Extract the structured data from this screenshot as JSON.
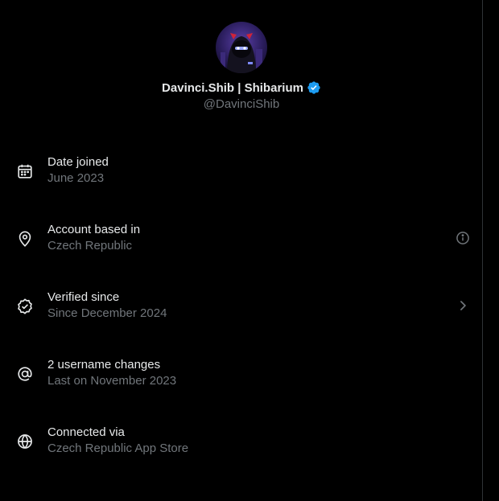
{
  "profile": {
    "display_name": "Davinci.Shib | Shibarium",
    "handle": "@DavinciShib",
    "verified": true,
    "avatar_icon": "hooded-ninja-avatar"
  },
  "rows": [
    {
      "icon": "calendar-icon",
      "title": "Date joined",
      "subtitle": "June 2023",
      "action": ""
    },
    {
      "icon": "location-pin-icon",
      "title": "Account based in",
      "subtitle": "Czech Republic",
      "action": "info-icon"
    },
    {
      "icon": "verified-check-icon",
      "title": "Verified since",
      "subtitle": "Since December 2024",
      "action": "chevron-right-icon"
    },
    {
      "icon": "at-sign-icon",
      "title": "2 username changes",
      "subtitle": "Last on November 2023",
      "action": ""
    },
    {
      "icon": "globe-icon",
      "title": "Connected via",
      "subtitle": "Czech Republic App Store",
      "action": ""
    }
  ],
  "colors": {
    "background": "#000000",
    "primary_text": "#e7e9ea",
    "secondary_text": "#71767b",
    "verified_blue": "#1d9bf0",
    "divider": "#2f3336"
  }
}
